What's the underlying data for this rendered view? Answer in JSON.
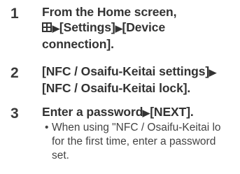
{
  "steps": [
    {
      "number": "1",
      "line1": "From the Home screen,",
      "line2_after_icon": "[Settings]",
      "line2_end": "[Device",
      "line3": "connection].",
      "icon": "app-grid-icon"
    },
    {
      "number": "2",
      "line1": "[NFC / Osaifu-Keitai settings]",
      "line2": "[NFC / Osaifu-Keitai lock]."
    },
    {
      "number": "3",
      "line1_start": "Enter a password",
      "line1_end": "[NEXT].",
      "note": {
        "bullet": "•",
        "line1": "When using \"NFC / Osaifu-Keitai lo",
        "line2": "for the first time, enter a password",
        "line3": "set."
      }
    }
  ],
  "arrow_glyph": "▶"
}
